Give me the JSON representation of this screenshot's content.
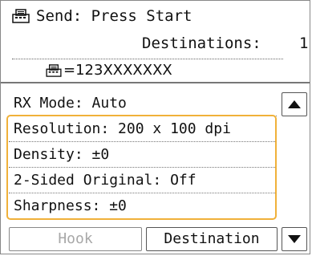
{
  "header": {
    "status_text": "Send: Press Start",
    "destinations_label": "Destinations:",
    "destinations_count": "1",
    "fax_number": "=123XXXXXXX",
    "icon": "fax-icon"
  },
  "list": {
    "items": [
      {
        "label": "RX Mode: Auto"
      },
      {
        "label": "Resolution: 200 x 100 dpi"
      },
      {
        "label": "Density: ±0"
      },
      {
        "label": "2-Sided Original: Off"
      },
      {
        "label": "Sharpness: ±0"
      }
    ],
    "highlight_color": "#f0b13a"
  },
  "buttons": {
    "hook_label": "Hook",
    "destination_label": "Destination",
    "hook_disabled_color": "#a8a8a8"
  },
  "scroll": {
    "up_icon": "triangle-up-icon",
    "down_icon": "triangle-down-icon"
  }
}
